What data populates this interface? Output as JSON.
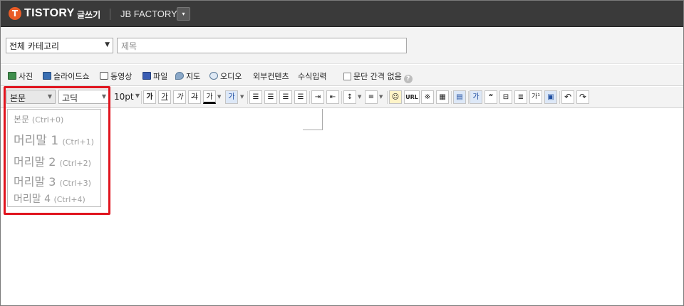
{
  "header": {
    "logo_glyph": "T",
    "brand": "TISTORY",
    "mode": "글쓰기",
    "blog_name": "JB FACTORY",
    "blog_dropdown_glyph": "▾"
  },
  "post": {
    "category_selected": "전체 카테고리",
    "title_placeholder": "제목"
  },
  "attachments": {
    "items": [
      "사진",
      "슬라이드쇼",
      "동영상",
      "파일",
      "지도",
      "오디오",
      "외부컨텐츠",
      "수식입력"
    ],
    "no_paragraph_spacing_label": "문단 간격 없음",
    "help_glyph": "?"
  },
  "toolbar": {
    "paragraph_style": "본문",
    "font": "고딕",
    "font_size": "10pt",
    "bold": "가",
    "italic": "가",
    "underline": "가",
    "strike": "가",
    "font_color": "가",
    "background_color": "가",
    "url": "URL",
    "special_char": "※",
    "fullwidth": "가",
    "quote": "“",
    "hanja": "가¹",
    "undo": "↶",
    "redo": "↷"
  },
  "heading_menu": {
    "items": [
      {
        "label": "본문",
        "shortcut": "(Ctrl+0)"
      },
      {
        "label": "머리말 1",
        "shortcut": "(Ctrl+1)"
      },
      {
        "label": "머리말 2",
        "shortcut": "(Ctrl+2)"
      },
      {
        "label": "머리말 3",
        "shortcut": "(Ctrl+3)"
      },
      {
        "label": "머리말 4",
        "shortcut": "(Ctrl+4)"
      }
    ]
  },
  "colors": {
    "brand_orange": "#ea5b26",
    "topbar_bg": "#3a3a3a",
    "highlight_red": "#e0141e"
  }
}
